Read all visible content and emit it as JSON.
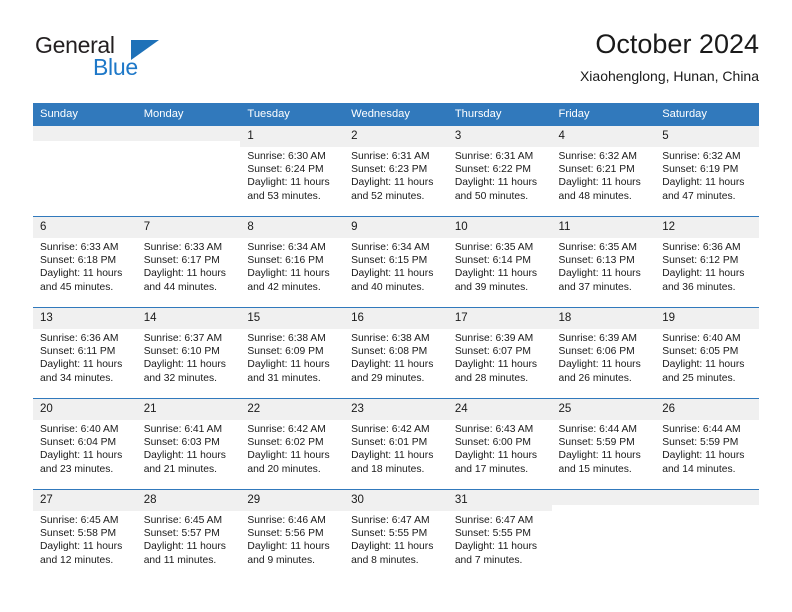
{
  "brand": {
    "name_part1": "General",
    "name_part2": "Blue",
    "accent_color": "#1e78c8",
    "triangle_color": "#1e71b8"
  },
  "header": {
    "title": "October 2024",
    "subtitle": "Xiaohenglong, Hunan, China",
    "header_bg": "#3179bc",
    "header_text_color": "#ffffff"
  },
  "calendar": {
    "weekday_headers": [
      "Sunday",
      "Monday",
      "Tuesday",
      "Wednesday",
      "Thursday",
      "Friday",
      "Saturday"
    ],
    "weeks": [
      [
        {
          "day": "",
          "blank": true
        },
        {
          "day": "",
          "blank": true
        },
        {
          "day": "1",
          "sunrise": "Sunrise: 6:30 AM",
          "sunset": "Sunset: 6:24 PM",
          "daylight_line1": "Daylight: 11 hours",
          "daylight_line2": "and 53 minutes."
        },
        {
          "day": "2",
          "sunrise": "Sunrise: 6:31 AM",
          "sunset": "Sunset: 6:23 PM",
          "daylight_line1": "Daylight: 11 hours",
          "daylight_line2": "and 52 minutes."
        },
        {
          "day": "3",
          "sunrise": "Sunrise: 6:31 AM",
          "sunset": "Sunset: 6:22 PM",
          "daylight_line1": "Daylight: 11 hours",
          "daylight_line2": "and 50 minutes."
        },
        {
          "day": "4",
          "sunrise": "Sunrise: 6:32 AM",
          "sunset": "Sunset: 6:21 PM",
          "daylight_line1": "Daylight: 11 hours",
          "daylight_line2": "and 48 minutes."
        },
        {
          "day": "5",
          "sunrise": "Sunrise: 6:32 AM",
          "sunset": "Sunset: 6:19 PM",
          "daylight_line1": "Daylight: 11 hours",
          "daylight_line2": "and 47 minutes."
        }
      ],
      [
        {
          "day": "6",
          "sunrise": "Sunrise: 6:33 AM",
          "sunset": "Sunset: 6:18 PM",
          "daylight_line1": "Daylight: 11 hours",
          "daylight_line2": "and 45 minutes."
        },
        {
          "day": "7",
          "sunrise": "Sunrise: 6:33 AM",
          "sunset": "Sunset: 6:17 PM",
          "daylight_line1": "Daylight: 11 hours",
          "daylight_line2": "and 44 minutes."
        },
        {
          "day": "8",
          "sunrise": "Sunrise: 6:34 AM",
          "sunset": "Sunset: 6:16 PM",
          "daylight_line1": "Daylight: 11 hours",
          "daylight_line2": "and 42 minutes."
        },
        {
          "day": "9",
          "sunrise": "Sunrise: 6:34 AM",
          "sunset": "Sunset: 6:15 PM",
          "daylight_line1": "Daylight: 11 hours",
          "daylight_line2": "and 40 minutes."
        },
        {
          "day": "10",
          "sunrise": "Sunrise: 6:35 AM",
          "sunset": "Sunset: 6:14 PM",
          "daylight_line1": "Daylight: 11 hours",
          "daylight_line2": "and 39 minutes."
        },
        {
          "day": "11",
          "sunrise": "Sunrise: 6:35 AM",
          "sunset": "Sunset: 6:13 PM",
          "daylight_line1": "Daylight: 11 hours",
          "daylight_line2": "and 37 minutes."
        },
        {
          "day": "12",
          "sunrise": "Sunrise: 6:36 AM",
          "sunset": "Sunset: 6:12 PM",
          "daylight_line1": "Daylight: 11 hours",
          "daylight_line2": "and 36 minutes."
        }
      ],
      [
        {
          "day": "13",
          "sunrise": "Sunrise: 6:36 AM",
          "sunset": "Sunset: 6:11 PM",
          "daylight_line1": "Daylight: 11 hours",
          "daylight_line2": "and 34 minutes."
        },
        {
          "day": "14",
          "sunrise": "Sunrise: 6:37 AM",
          "sunset": "Sunset: 6:10 PM",
          "daylight_line1": "Daylight: 11 hours",
          "daylight_line2": "and 32 minutes."
        },
        {
          "day": "15",
          "sunrise": "Sunrise: 6:38 AM",
          "sunset": "Sunset: 6:09 PM",
          "daylight_line1": "Daylight: 11 hours",
          "daylight_line2": "and 31 minutes."
        },
        {
          "day": "16",
          "sunrise": "Sunrise: 6:38 AM",
          "sunset": "Sunset: 6:08 PM",
          "daylight_line1": "Daylight: 11 hours",
          "daylight_line2": "and 29 minutes."
        },
        {
          "day": "17",
          "sunrise": "Sunrise: 6:39 AM",
          "sunset": "Sunset: 6:07 PM",
          "daylight_line1": "Daylight: 11 hours",
          "daylight_line2": "and 28 minutes."
        },
        {
          "day": "18",
          "sunrise": "Sunrise: 6:39 AM",
          "sunset": "Sunset: 6:06 PM",
          "daylight_line1": "Daylight: 11 hours",
          "daylight_line2": "and 26 minutes."
        },
        {
          "day": "19",
          "sunrise": "Sunrise: 6:40 AM",
          "sunset": "Sunset: 6:05 PM",
          "daylight_line1": "Daylight: 11 hours",
          "daylight_line2": "and 25 minutes."
        }
      ],
      [
        {
          "day": "20",
          "sunrise": "Sunrise: 6:40 AM",
          "sunset": "Sunset: 6:04 PM",
          "daylight_line1": "Daylight: 11 hours",
          "daylight_line2": "and 23 minutes."
        },
        {
          "day": "21",
          "sunrise": "Sunrise: 6:41 AM",
          "sunset": "Sunset: 6:03 PM",
          "daylight_line1": "Daylight: 11 hours",
          "daylight_line2": "and 21 minutes."
        },
        {
          "day": "22",
          "sunrise": "Sunrise: 6:42 AM",
          "sunset": "Sunset: 6:02 PM",
          "daylight_line1": "Daylight: 11 hours",
          "daylight_line2": "and 20 minutes."
        },
        {
          "day": "23",
          "sunrise": "Sunrise: 6:42 AM",
          "sunset": "Sunset: 6:01 PM",
          "daylight_line1": "Daylight: 11 hours",
          "daylight_line2": "and 18 minutes."
        },
        {
          "day": "24",
          "sunrise": "Sunrise: 6:43 AM",
          "sunset": "Sunset: 6:00 PM",
          "daylight_line1": "Daylight: 11 hours",
          "daylight_line2": "and 17 minutes."
        },
        {
          "day": "25",
          "sunrise": "Sunrise: 6:44 AM",
          "sunset": "Sunset: 5:59 PM",
          "daylight_line1": "Daylight: 11 hours",
          "daylight_line2": "and 15 minutes."
        },
        {
          "day": "26",
          "sunrise": "Sunrise: 6:44 AM",
          "sunset": "Sunset: 5:59 PM",
          "daylight_line1": "Daylight: 11 hours",
          "daylight_line2": "and 14 minutes."
        }
      ],
      [
        {
          "day": "27",
          "sunrise": "Sunrise: 6:45 AM",
          "sunset": "Sunset: 5:58 PM",
          "daylight_line1": "Daylight: 11 hours",
          "daylight_line2": "and 12 minutes."
        },
        {
          "day": "28",
          "sunrise": "Sunrise: 6:45 AM",
          "sunset": "Sunset: 5:57 PM",
          "daylight_line1": "Daylight: 11 hours",
          "daylight_line2": "and 11 minutes."
        },
        {
          "day": "29",
          "sunrise": "Sunrise: 6:46 AM",
          "sunset": "Sunset: 5:56 PM",
          "daylight_line1": "Daylight: 11 hours",
          "daylight_line2": "and 9 minutes."
        },
        {
          "day": "30",
          "sunrise": "Sunrise: 6:47 AM",
          "sunset": "Sunset: 5:55 PM",
          "daylight_line1": "Daylight: 11 hours",
          "daylight_line2": "and 8 minutes."
        },
        {
          "day": "31",
          "sunrise": "Sunrise: 6:47 AM",
          "sunset": "Sunset: 5:55 PM",
          "daylight_line1": "Daylight: 11 hours",
          "daylight_line2": "and 7 minutes."
        },
        {
          "day": "",
          "blank": true
        },
        {
          "day": "",
          "blank": true
        }
      ]
    ]
  }
}
